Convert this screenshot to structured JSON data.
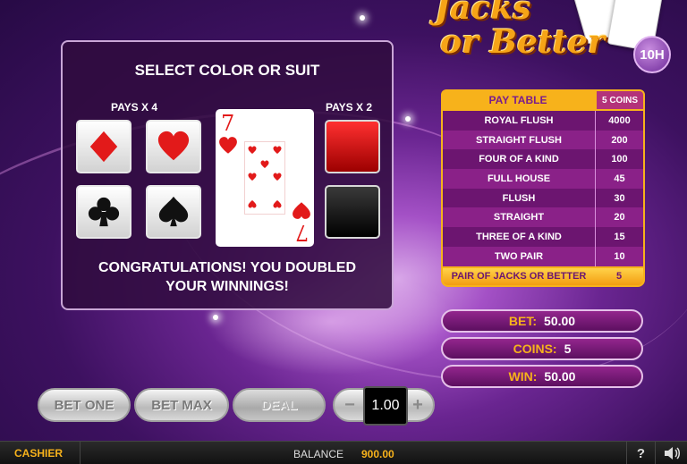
{
  "logo": {
    "line1": "Jacks",
    "line2": "or Better",
    "badge": "10H"
  },
  "gamble": {
    "title": "SELECT COLOR OR SUIT",
    "pays_suit": "PAYS X 4",
    "pays_color": "PAYS X 2",
    "card": {
      "rank": "7",
      "suit": "heart"
    },
    "message_line1": "CONGRATULATIONS! YOU DOUBLED",
    "message_line2": "YOUR WINNINGS!"
  },
  "paytable": {
    "header_label": "PAY TABLE",
    "header_coins": "5 COINS",
    "rows": [
      {
        "name": "ROYAL FLUSH",
        "value": "4000"
      },
      {
        "name": "STRAIGHT FLUSH",
        "value": "200"
      },
      {
        "name": "FOUR OF A KIND",
        "value": "100"
      },
      {
        "name": "FULL HOUSE",
        "value": "45"
      },
      {
        "name": "FLUSH",
        "value": "30"
      },
      {
        "name": "STRAIGHT",
        "value": "20"
      },
      {
        "name": "THREE OF A KIND",
        "value": "15"
      },
      {
        "name": "TWO PAIR",
        "value": "10"
      },
      {
        "name": "PAIR OF  JACKS OR BETTER",
        "value": "5"
      }
    ],
    "highlighted_row": 8
  },
  "info": {
    "bet_label": "BET:",
    "bet_value": "50.00",
    "coins_label": "COINS:",
    "coins_value": "5",
    "win_label": "WIN:",
    "win_value": "50.00"
  },
  "controls": {
    "bet_one": "BET ONE",
    "bet_max": "BET MAX",
    "deal": "DEAL",
    "coin_value": "1.00",
    "minus": "−",
    "plus": "+"
  },
  "statusbar": {
    "cashier": "CASHIER",
    "balance_label": "BALANCE",
    "balance_value": "900.00",
    "help": "?"
  },
  "colors": {
    "accent": "#f7b21b",
    "red": "#e21a1a",
    "panel": "#300c3e"
  },
  "icons": [
    "diamond-icon",
    "heart-icon",
    "club-icon",
    "spade-icon",
    "help-icon",
    "sound-icon"
  ]
}
